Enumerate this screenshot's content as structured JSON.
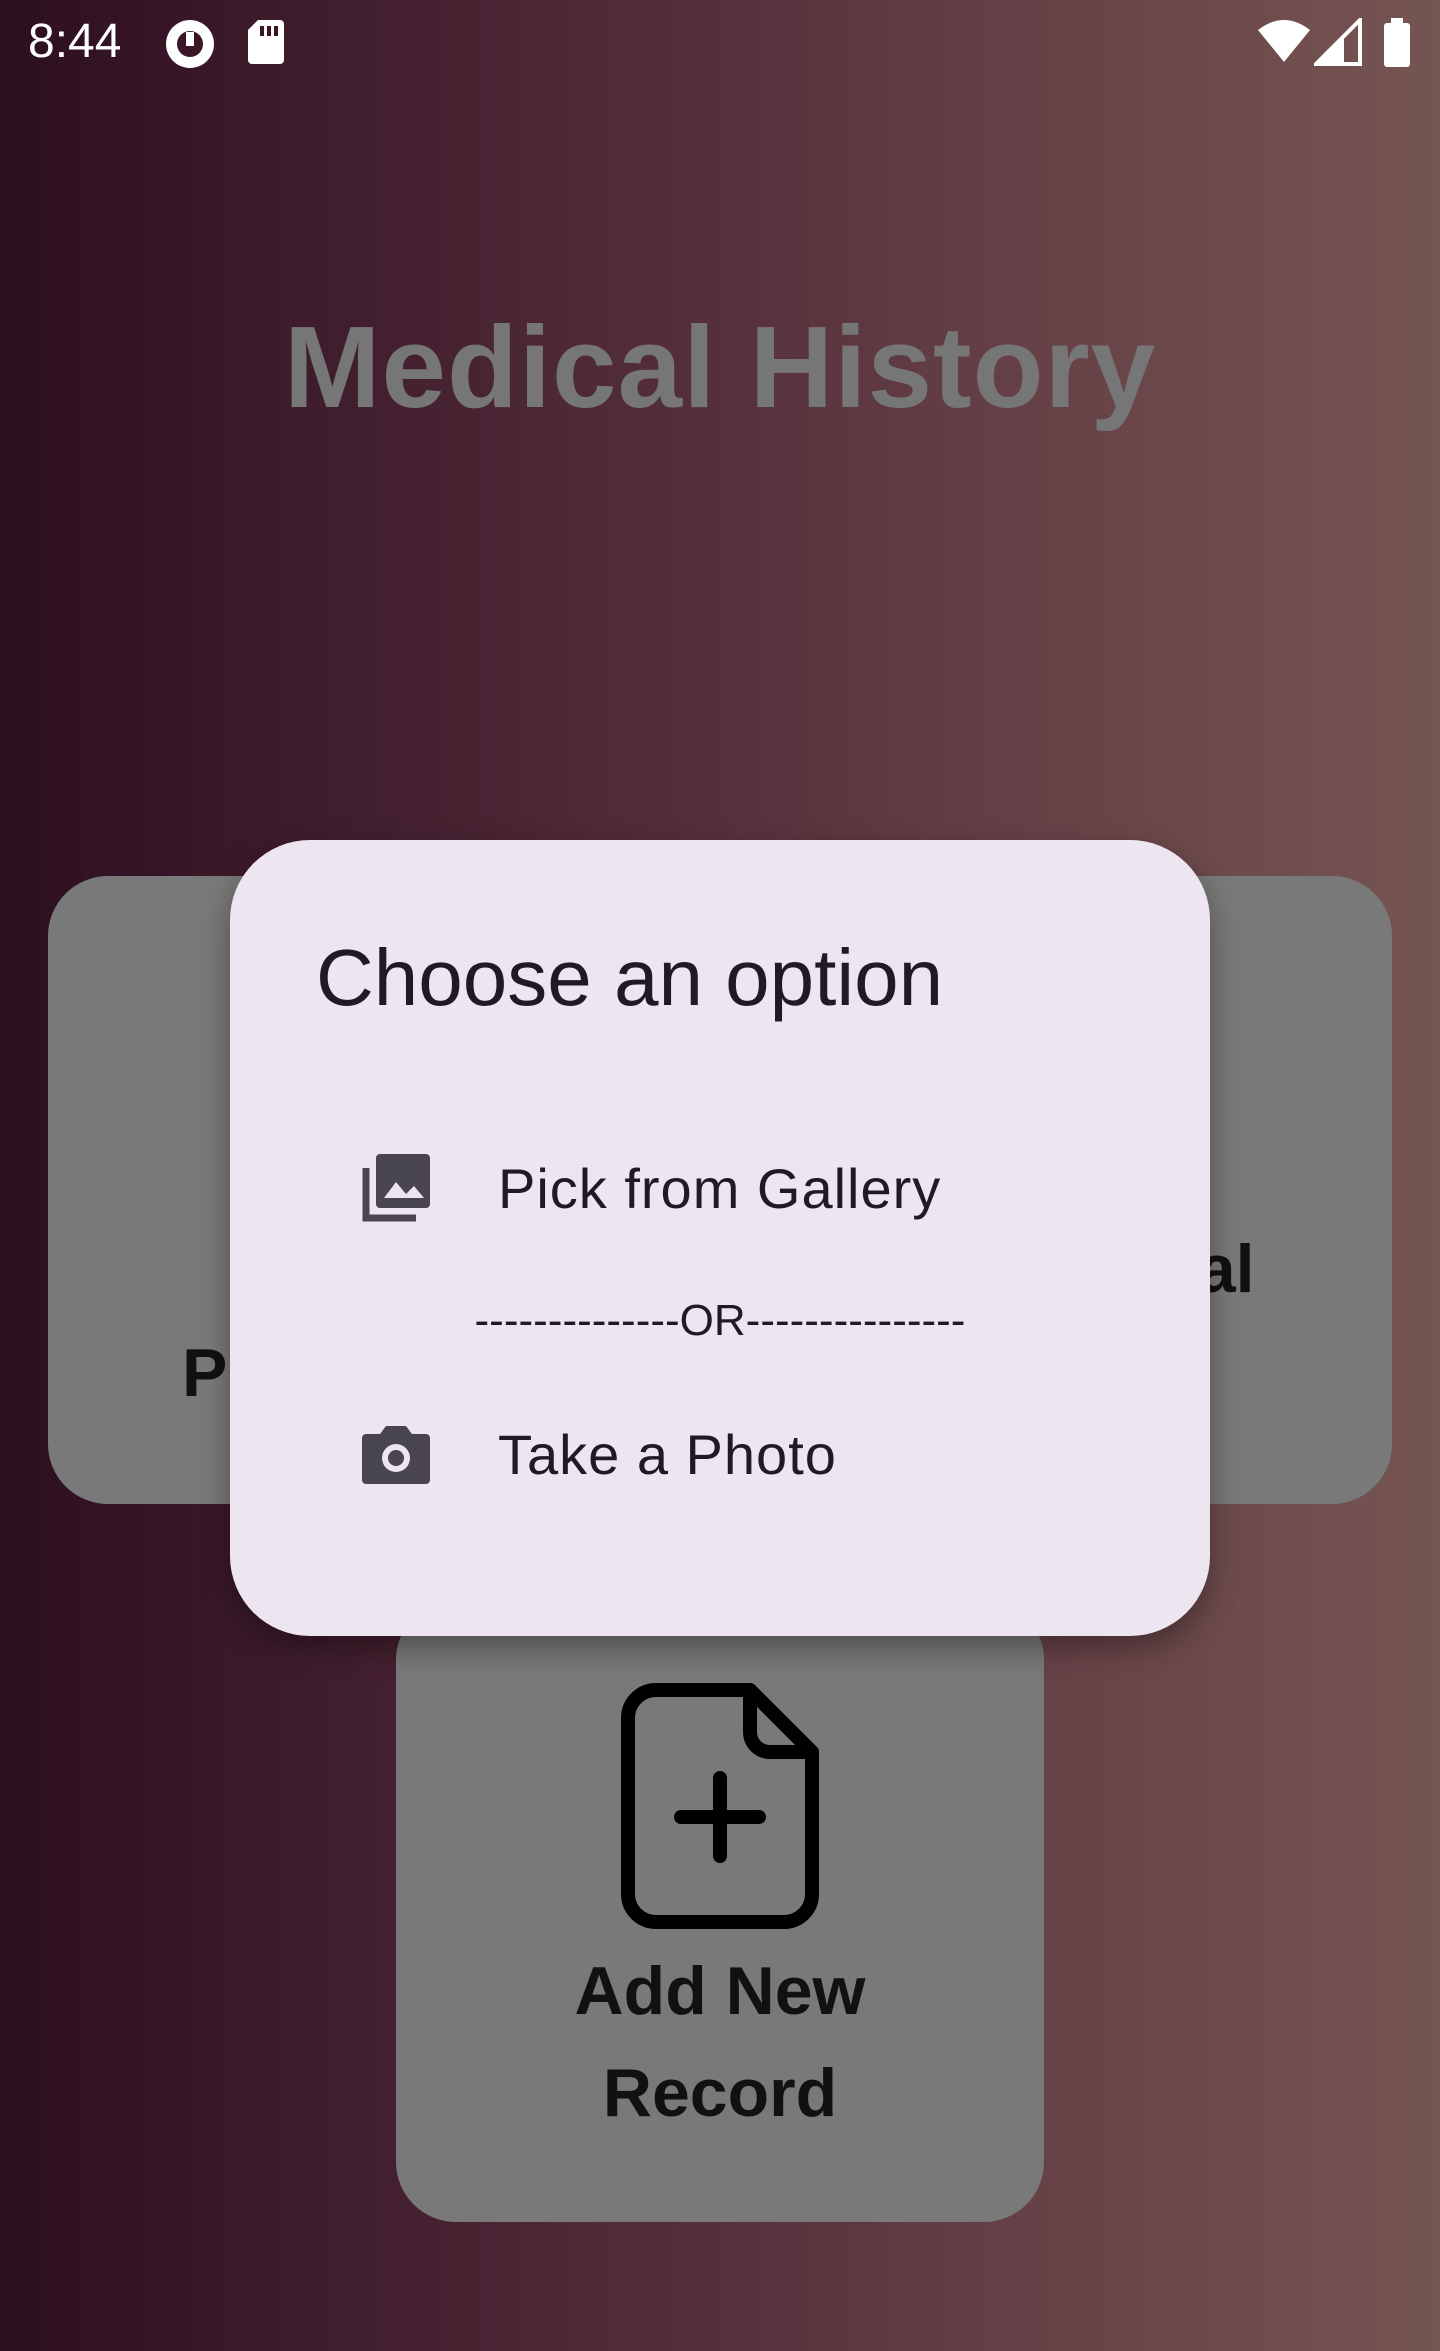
{
  "status_bar": {
    "time": "8:44",
    "icons": [
      "pocket-casts-icon",
      "sd-card-icon",
      "wifi-icon",
      "cell-signal-icon",
      "battery-icon"
    ]
  },
  "page": {
    "title": "Medical History"
  },
  "background_cards": {
    "left_label": "P",
    "right_label": "cal",
    "bottom_label_line1": "Add New",
    "bottom_label_line2": "Record",
    "bottom_icon": "file-add-icon"
  },
  "dialog": {
    "title": "Choose an option",
    "option_gallery": {
      "label": "Pick from Gallery",
      "icon": "photo-library-icon"
    },
    "divider": "--------------OR---------------",
    "option_photo": {
      "label": "Take a Photo",
      "icon": "camera-icon"
    }
  },
  "colors": {
    "dialog_bg": "#ede6f1",
    "card_bg": "#797979",
    "title_color": "#777676"
  }
}
